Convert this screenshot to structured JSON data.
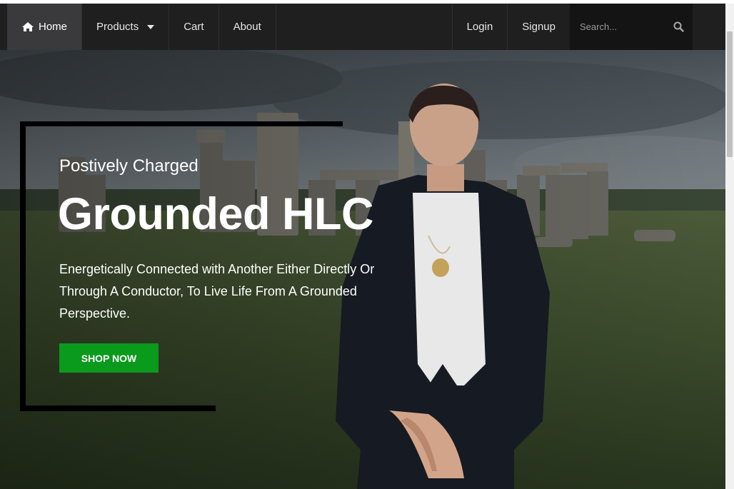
{
  "navbar": {
    "home_label": "Home",
    "products_label": "Products",
    "cart_label": "Cart",
    "about_label": "About",
    "login_label": "Login",
    "signup_label": "Signup",
    "search_placeholder": "Search..."
  },
  "hero": {
    "eyebrow": "Postively Charged",
    "headline": "Grounded HLC",
    "description": "Energetically Connected with Another Either Directly Or Through A Conductor, To Live Life From A Grounded Perspective.",
    "cta_label": "SHOP NOW"
  },
  "colors": {
    "navbar_bg": "#1f1f20",
    "active_nav_bg": "#3a3a3c",
    "search_bg": "#141415",
    "cta_green": "#0a9a1c",
    "frame": "#000000"
  },
  "icons": [
    "home-icon",
    "caret-down-icon",
    "search-icon"
  ]
}
